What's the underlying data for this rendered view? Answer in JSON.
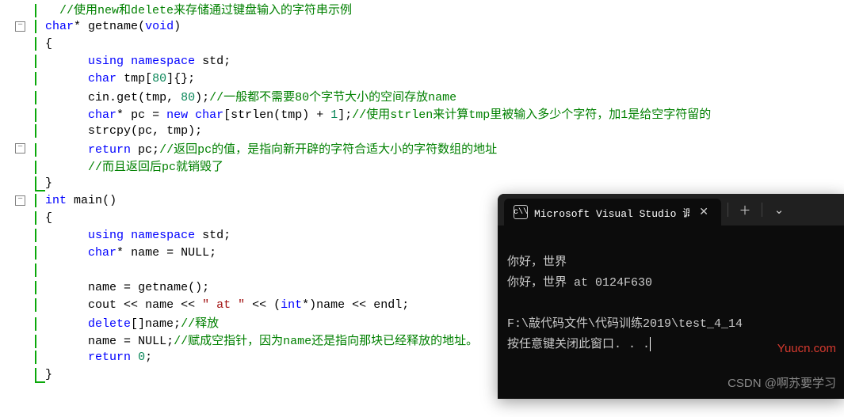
{
  "code": {
    "l1_cmt": "//使用new和delete来存储通过键盘输入的字符串示例",
    "l2_type": "char",
    "l2_fn": "getname",
    "l2_void": "void",
    "l4": "using namespace std;",
    "l5": "char tmp[80]{};",
    "l6_a": "cin.get(tmp, 80);",
    "l6_cmt": "//一般都不需要80个字节大小的空间存放name",
    "l7_a": "char* pc = ",
    "l7_new": "new",
    "l7_b": " char[strlen(tmp) + 1];",
    "l7_cmt": "//使用strlen来计算tmp里被输入多少个字符，加1是给空字符留的",
    "l8": "strcpy(pc, tmp);",
    "l9_a": "return",
    "l9_b": " pc;",
    "l9_cmt": "//返回pc的值，是指向新开辟的字符合适大小的字符数组的地址",
    "l10_cmt": "//而且返回后pc就销毁了",
    "l12_type": "int",
    "l12_fn": "main",
    "l14": "using namespace std;",
    "l15_a": "char* name = ",
    "l15_null": "NULL",
    "l17": "name = getname();",
    "l18_a": "cout << name << ",
    "l18_str": "\" at \"",
    "l18_b": " << (int*)name << endl;",
    "l19_a": "delete",
    "l19_b": "[]name;",
    "l19_cmt": "//释放",
    "l20_a": "name = ",
    "l20_null": "NULL",
    "l20_cmt": "//赋成空指针，因为name还是指向那块已经释放的地址。",
    "l21": "return 0;"
  },
  "terminal": {
    "tab_title": "Microsoft Visual Studio 调试控",
    "out1": "你好，世界",
    "out2": "你好，世界 at 0124F630",
    "out3": "F:\\敲代码文件\\代码训练2019\\test_4_14",
    "out4": "按任意键关闭此窗口. . .",
    "watermark_red": "Yuucn.com",
    "watermark_grey": "CSDN @啊苏要学习"
  }
}
